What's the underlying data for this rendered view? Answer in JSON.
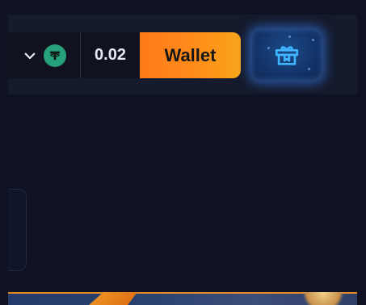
{
  "header": {
    "currency_selector": {
      "chevron_icon": "chevron-down-icon",
      "currency_icon": "tether-icon",
      "currency_icon_color": "#26a17b"
    },
    "balance": "0.02",
    "wallet_button_label": "Wallet",
    "wallet_button_color": "#ff7a1a",
    "gift_button_icon": "gift-icon",
    "gift_button_color": "#1b4a88"
  },
  "colors": {
    "background": "#0f1223",
    "topbar": "#151a2c"
  }
}
